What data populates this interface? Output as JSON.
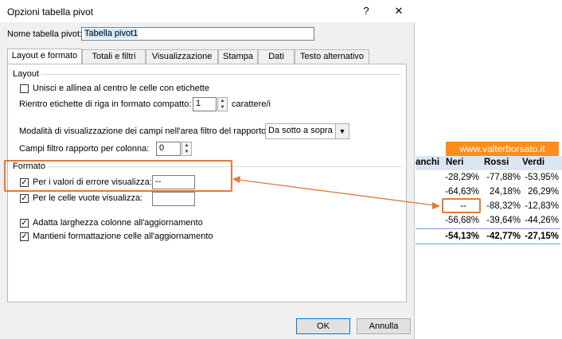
{
  "window": {
    "title": "Opzioni tabella pivot",
    "help_glyph": "?",
    "close_glyph": "✕"
  },
  "name_field": {
    "label": "Nome tabella pivot:",
    "value": "Tabella pivot1"
  },
  "tabs": [
    {
      "label": "Layout e formato",
      "active": true
    },
    {
      "label": "Totali e filtri"
    },
    {
      "label": "Visualizzazione"
    },
    {
      "label": "Stampa"
    },
    {
      "label": "Dati"
    },
    {
      "label": "Testo alternativo"
    }
  ],
  "layout": {
    "section": "Layout",
    "merge_label": "Unisci e allinea al centro le celle con etichette",
    "merge_checked": false,
    "indent_label": "Rientro etichette di riga in formato compatto:",
    "indent_value": "1",
    "indent_unit": "carattere/i",
    "filter_mode_label": "Modalità di visualizzazione dei campi nell'area filtro del rapporto:",
    "filter_mode_value": "Da sotto a sopra",
    "filter_cols_label": "Campi filtro rapporto per colonna:",
    "filter_cols_value": "0"
  },
  "formato": {
    "section": "Formato",
    "error_label": "Per i valori di errore visualizza:",
    "error_checked": true,
    "error_value": "--",
    "empty_label": "Per le celle vuote visualizza:",
    "empty_checked": true,
    "empty_value": "",
    "autofit_label": "Adatta larghezza colonne all'aggiornamento",
    "autofit_checked": true,
    "keep_format_label": "Mantieni formattazione celle all'aggiornamento",
    "keep_format_checked": true
  },
  "buttons": {
    "ok": "OK",
    "cancel": "Annulla"
  },
  "spreadsheet": {
    "brand": "www.valterborsato.it",
    "headers": [
      "anchi",
      "Neri",
      "Rossi",
      "Verdi"
    ],
    "rows": [
      [
        "-28,29%",
        "-77,88%",
        "-53,95%"
      ],
      [
        "-64,63%",
        "24,18%",
        "26,29%"
      ],
      [
        "--",
        "-88,32%",
        "-12,83%"
      ],
      [
        "-56,68%",
        "-39,64%",
        "-44,26%"
      ]
    ],
    "total": [
      "-54,13%",
      "-42,77%",
      "-27,15%"
    ]
  },
  "colors": {
    "accent": "#e07b39",
    "brand_bg": "#ff8c1a",
    "header_bg": "#dce6f1"
  }
}
